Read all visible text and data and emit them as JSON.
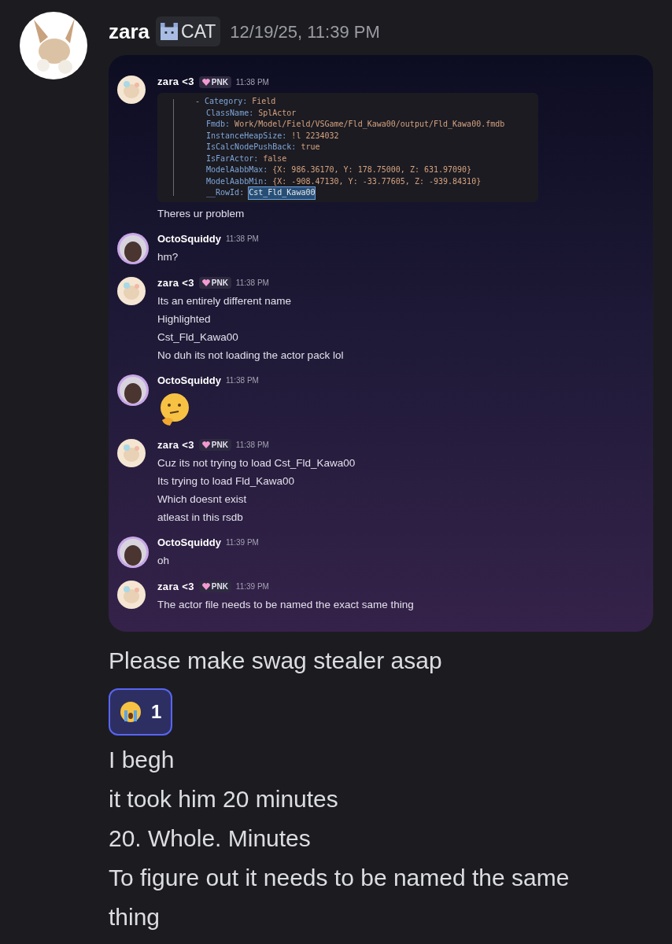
{
  "message": {
    "author": "zara",
    "tag": "CAT",
    "timestamp": "12/19/25, 11:39 PM",
    "screenshot": {
      "messages": [
        {
          "author": "zara <3",
          "kind": "zara",
          "tag": "PNK",
          "time": "11:38 PM",
          "blocks": [
            {
              "kind": "code",
              "lines": [
                {
                  "prefix": "-",
                  "key": "Category:",
                  "value": "Field",
                  "highlighted": false
                },
                {
                  "key": "ClassName:",
                  "value": "SplActor",
                  "highlighted": false
                },
                {
                  "key": "Fmdb:",
                  "value": "Work/Model/Field/VSGame/Fld_Kawa00/output/Fld_Kawa00.fmdb",
                  "highlighted": false
                },
                {
                  "key": "InstanceHeapSize:",
                  "value": "!l 2234032",
                  "highlighted": false
                },
                {
                  "key": "IsCalcNodePushBack:",
                  "value": "true",
                  "highlighted": false
                },
                {
                  "key": "IsFarActor:",
                  "value": "false",
                  "highlighted": false
                },
                {
                  "key": "ModelAabbMax:",
                  "value": "{X: 986.36170, Y: 178.75000, Z: 631.97090}",
                  "highlighted": false
                },
                {
                  "key": "ModelAabbMin:",
                  "value": "{X: -908.47130, Y: -33.77605, Z: -939.84310}",
                  "highlighted": false
                },
                {
                  "key": "__RowId:",
                  "value": "Cst_Fld_Kawa00",
                  "highlighted": true
                }
              ]
            },
            {
              "kind": "text",
              "text": "Theres ur problem"
            }
          ]
        },
        {
          "author": "OctoSquiddy",
          "kind": "octo",
          "time": "11:38 PM",
          "blocks": [
            {
              "kind": "text",
              "text": "hm?"
            }
          ]
        },
        {
          "author": "zara <3",
          "kind": "zara",
          "tag": "PNK",
          "time": "11:38 PM",
          "blocks": [
            {
              "kind": "text",
              "text": "Its an entirely different name"
            },
            {
              "kind": "text",
              "text": "Highlighted"
            },
            {
              "kind": "text",
              "text": "Cst_Fld_Kawa00"
            },
            {
              "kind": "text",
              "text": "No duh its not loading the actor pack lol"
            }
          ]
        },
        {
          "author": "OctoSquiddy",
          "kind": "octo",
          "time": "11:38 PM",
          "blocks": [
            {
              "kind": "emoji"
            }
          ]
        },
        {
          "author": "zara <3",
          "kind": "zara",
          "tag": "PNK",
          "time": "11:38 PM",
          "blocks": [
            {
              "kind": "text",
              "text": "Cuz its not trying to load Cst_Fld_Kawa00"
            },
            {
              "kind": "text",
              "text": "Its trying to load Fld_Kawa00"
            },
            {
              "kind": "text",
              "text": "Which doesnt exist"
            },
            {
              "kind": "text",
              "text": "atleast in this rsdb"
            }
          ]
        },
        {
          "author": "OctoSquiddy",
          "kind": "octo",
          "time": "11:39 PM",
          "blocks": [
            {
              "kind": "text",
              "text": "oh"
            }
          ]
        },
        {
          "author": "zara <3",
          "kind": "zara",
          "tag": "PNK",
          "time": "11:39 PM",
          "blocks": [
            {
              "kind": "text",
              "text": "The actor file needs to be named the exact same thing"
            }
          ]
        }
      ]
    },
    "lines": [
      "Please make swag stealer asap"
    ],
    "reaction": {
      "count": "1",
      "selected": true
    },
    "lines_after": [
      "I begh",
      "it took him 20 minutes",
      "20.  Whole. Minutes",
      "To figure out it needs to be named the same thing"
    ]
  }
}
